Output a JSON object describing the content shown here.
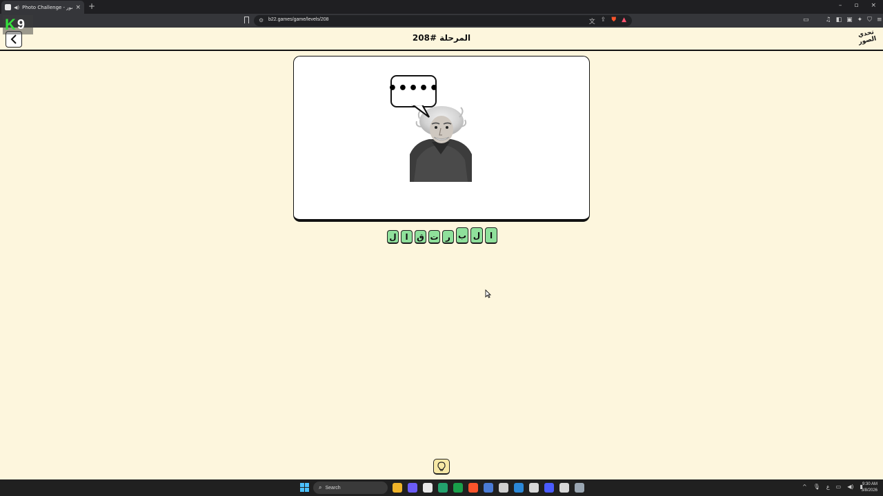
{
  "browser": {
    "tab_title": "Photo Challenge - تحدي الصور",
    "tab_close": "×",
    "new_tab": "+",
    "url": "b22.games/game/levels/208",
    "window_controls": [
      "–",
      "▫",
      "×"
    ]
  },
  "extension_logo": {
    "k": "K",
    "nine": "9"
  },
  "page": {
    "level_title": "المرحلة #208",
    "logo_text_line1": "تحدي",
    "logo_text_line2": "الصور"
  },
  "puzzle": {
    "bubble_text": "•••••",
    "tiles_rtl": [
      {
        "char": "ا",
        "size": "big"
      },
      {
        "char": "ل",
        "size": "big"
      },
      {
        "char": "ب",
        "size": "big"
      },
      {
        "char": "ر",
        "size": "small"
      },
      {
        "char": "ت",
        "size": "small"
      },
      {
        "char": "ق",
        "size": "small"
      },
      {
        "char": "ا",
        "size": "small"
      },
      {
        "char": "ل",
        "size": "small"
      }
    ]
  },
  "taskbar": {
    "search_label": "Search",
    "time": "9:30 AM",
    "date": "3/8/2026",
    "apps": [
      "#f0b429",
      "#6b5cf6",
      "#e8e8e8",
      "#23a26d",
      "#19a04a",
      "#fb542b",
      "#4a7bd6",
      "#cfcfcf",
      "#2b88d8",
      "#d8d8d8",
      "#4a5cff",
      "#d8d8d8",
      "#9aa6b2"
    ]
  },
  "colors": {
    "page_bg": "#fdf6dd",
    "tile_green": "#8fe09b",
    "hint_bg": "#f7e9a6"
  }
}
